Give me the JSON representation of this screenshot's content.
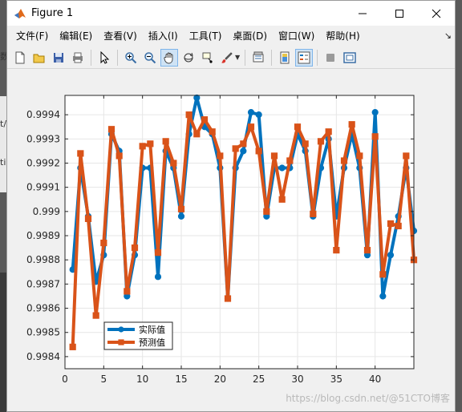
{
  "window": {
    "title": "Figure 1",
    "menu": [
      "文件(F)",
      "编辑(E)",
      "查看(V)",
      "插入(I)",
      "工具(T)",
      "桌面(D)",
      "窗口(W)",
      "帮助(H)"
    ]
  },
  "background": {
    "fragment_left": "数",
    "fragment_left2": "t/",
    "fragment_left3": "ti"
  },
  "watermark": "https://blog.csdn.net/@51CTO博客",
  "colors": {
    "series1": "#0072BD",
    "series2": "#D95319",
    "axes_bg": "#ffffff",
    "grid": "#e6e6e6"
  },
  "chart_data": {
    "type": "line",
    "xlim": [
      0,
      45
    ],
    "ylim": [
      0.99835,
      0.99948
    ],
    "xticks": [
      "0",
      "5",
      "10",
      "15",
      "20",
      "25",
      "30",
      "35",
      "40"
    ],
    "xtick_values": [
      0,
      5,
      10,
      15,
      20,
      25,
      30,
      35,
      40
    ],
    "yticks": [
      "0.9984",
      "0.9985",
      "0.9986",
      "0.9987",
      "0.9988",
      "0.9989",
      "0.999",
      "0.9991",
      "0.9992",
      "0.9993",
      "0.9994"
    ],
    "ytick_values": [
      0.9984,
      0.9985,
      0.9986,
      0.9987,
      0.9988,
      0.9989,
      0.999,
      0.9991,
      0.9992,
      0.9993,
      0.9994
    ],
    "grid": true,
    "legend_position": "bottom-left",
    "x": [
      1,
      2,
      3,
      4,
      5,
      6,
      7,
      8,
      9,
      10,
      11,
      12,
      13,
      14,
      15,
      16,
      17,
      18,
      19,
      20,
      21,
      22,
      23,
      24,
      25,
      26,
      27,
      28,
      29,
      30,
      31,
      32,
      33,
      34,
      35,
      36,
      37,
      38,
      39,
      40,
      41,
      42,
      43,
      44,
      45
    ],
    "series": [
      {
        "name": "实际值",
        "marker": "circle",
        "values": [
          0.99876,
          0.99918,
          0.99898,
          0.99871,
          0.99882,
          0.99932,
          0.99925,
          0.99865,
          0.99882,
          0.99918,
          0.99918,
          0.99873,
          0.99925,
          0.99918,
          0.99898,
          0.99932,
          0.99947,
          0.99935,
          0.99932,
          0.99918,
          0.99864,
          0.99918,
          0.99925,
          0.99941,
          0.9994,
          0.99898,
          0.99918,
          0.99918,
          0.99918,
          0.99932,
          0.99925,
          0.99898,
          0.99918,
          0.9993,
          0.99898,
          0.99918,
          0.99932,
          0.99918,
          0.99882,
          0.99941,
          0.99865,
          0.99882,
          0.99898,
          0.99918,
          0.99892
        ]
      },
      {
        "name": "预测值",
        "marker": "square",
        "values": [
          0.99844,
          0.99924,
          0.99897,
          0.99857,
          0.99887,
          0.99934,
          0.99923,
          0.99867,
          0.99885,
          0.99927,
          0.99928,
          0.99883,
          0.99929,
          0.9992,
          0.99901,
          0.9994,
          0.99932,
          0.99938,
          0.99933,
          0.99923,
          0.99864,
          0.99926,
          0.99928,
          0.99935,
          0.99925,
          0.999,
          0.99923,
          0.99905,
          0.99921,
          0.99935,
          0.99928,
          0.99899,
          0.99929,
          0.99933,
          0.99884,
          0.99921,
          0.99936,
          0.99923,
          0.99884,
          0.99931,
          0.99874,
          0.99895,
          0.99894,
          0.99923,
          0.9988
        ]
      }
    ]
  }
}
